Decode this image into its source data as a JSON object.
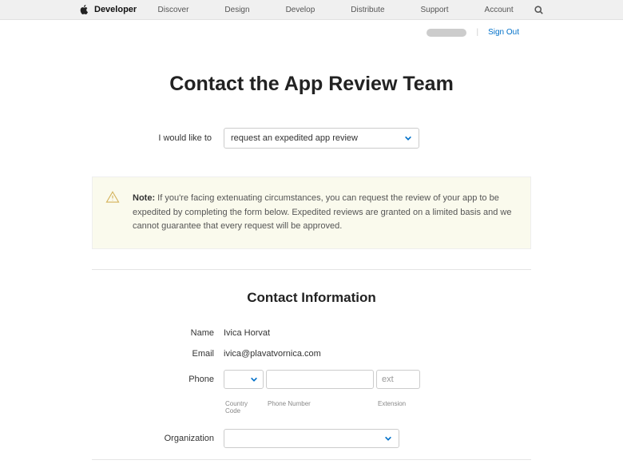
{
  "nav": {
    "brand": "Developer",
    "items": [
      "Discover",
      "Design",
      "Develop",
      "Distribute",
      "Support",
      "Account"
    ]
  },
  "userbar": {
    "sign_out": "Sign Out"
  },
  "page": {
    "title": "Contact the App Review Team"
  },
  "request": {
    "label": "I would like to",
    "selected": "request an expedited app review"
  },
  "note": {
    "label": "Note:",
    "text": "If you're facing extenuating circumstances, you can request the review of your app to be expedited by completing the form below. Expedited reviews are granted on a limited basis and we cannot guarantee that every request will be approved."
  },
  "contact": {
    "section_title": "Contact Information",
    "name_label": "Name",
    "name_value": "Ivica Horvat",
    "email_label": "Email",
    "email_value": "ivica@plavatvornica.com",
    "phone_label": "Phone",
    "cc_hint": "Country Code",
    "phone_hint": "Phone Number",
    "ext_placeholder": "ext",
    "ext_hint": "Extension",
    "org_label": "Organization"
  }
}
